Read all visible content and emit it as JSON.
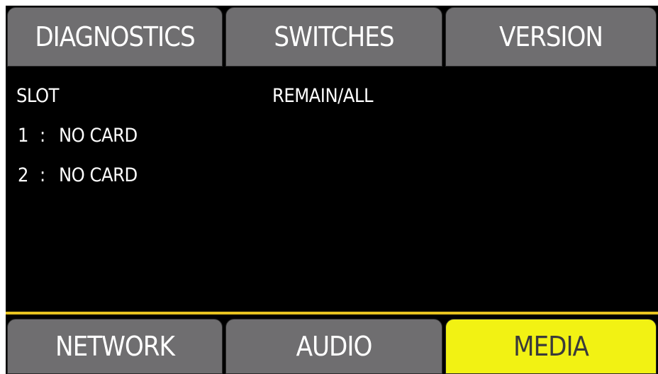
{
  "top_tabs": [
    {
      "label": "DIAGNOSTICS",
      "active": false
    },
    {
      "label": "SWITCHES",
      "active": false
    },
    {
      "label": "VERSION",
      "active": false
    }
  ],
  "content": {
    "slot_header": "SLOT",
    "remain_header": "REMAIN/ALL",
    "slots": [
      {
        "number": "1",
        "separator": ":",
        "status": "NO CARD"
      },
      {
        "number": "2",
        "separator": ":",
        "status": "NO CARD"
      }
    ]
  },
  "bottom_tabs": [
    {
      "label": "NETWORK",
      "active": false
    },
    {
      "label": "AUDIO",
      "active": false
    },
    {
      "label": "MEDIA",
      "active": true
    }
  ],
  "colors": {
    "background": "#000000",
    "tab_inactive": "#6f6e70",
    "tab_active": "#f2f213",
    "accent_line": "#e8c320"
  }
}
